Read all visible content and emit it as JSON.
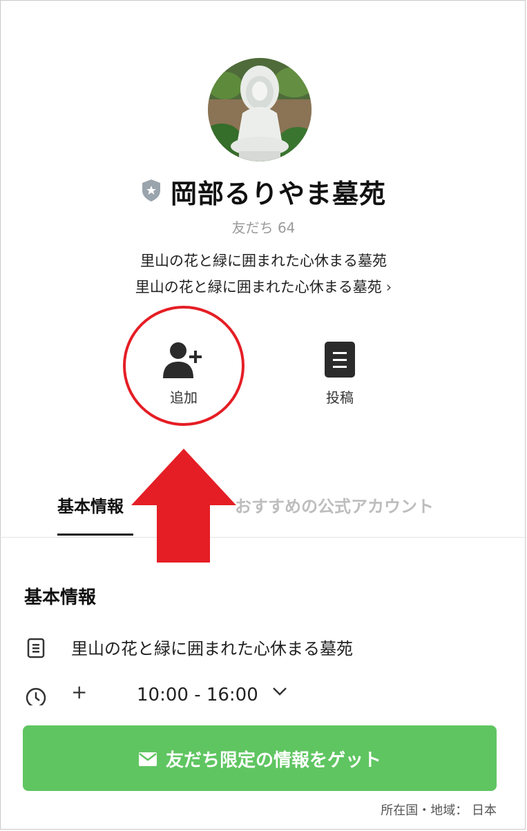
{
  "profile": {
    "name": "岡部るりやま墓苑",
    "friends": "友だち 64",
    "description_line1": "里山の花と緑に囲まれた心休まる墓苑",
    "description_line2": "里山の花と緑に囲まれた心休まる墓苑",
    "more_chevron": "›"
  },
  "actions": {
    "add_label": "追加",
    "post_label": "投稿"
  },
  "tabs": {
    "basic": "基本情報",
    "recommended": "おすすめの公式アカウント"
  },
  "info": {
    "section_title": "基本情報",
    "description": "里山の花と緑に囲まれた心休まる墓苑",
    "hours_plus": "+",
    "hours": "10:00 - 16:00"
  },
  "cta": {
    "label": "友だち限定の情報をゲット"
  },
  "footer": {
    "country": "所在国・地域： 日本"
  },
  "colors": {
    "accent_green": "#5fc561",
    "annotation_red": "#e51e25"
  }
}
